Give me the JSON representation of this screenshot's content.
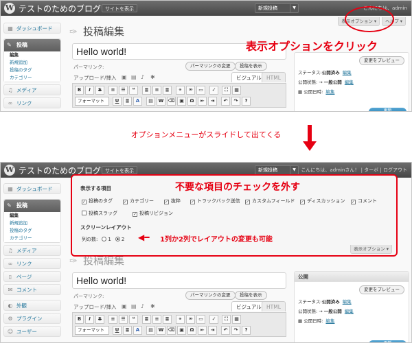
{
  "admin_bar": {
    "site_title": "テストのためのブログ",
    "view_site": "サイトを表示",
    "new_post": "新規投稿",
    "greeting": "こんにちは、adminさん！ | ターボ | ログアウト",
    "greeting_short": "こんにちは、admin"
  },
  "screen_options": {
    "label": "表示オプション ▾",
    "help": "ヘルプ ▾"
  },
  "sidebar": {
    "dashboard": "ダッシュボード",
    "posts": "投稿",
    "posts_sub": [
      "編集",
      "新規追加",
      "投稿のタグ",
      "カテゴリー"
    ],
    "media": "メディア",
    "links": "リンク",
    "pages": "ページ",
    "comments": "コメント",
    "appearance": "外観",
    "plugins": "プラグイン",
    "users": "ユーザー"
  },
  "page": {
    "title": "投稿編集"
  },
  "editor": {
    "post_title": "Hello world!",
    "permalink_label": "パーマリンク:",
    "change_permalink": "パーマリンクの変更",
    "view_post": "投稿を表示",
    "upload_label": "アップロード/挿入",
    "tab_visual": "ビジュアル",
    "tab_html": "HTML",
    "format_select": "フォーマット"
  },
  "publish_box": {
    "heading": "公開",
    "preview": "変更をプレビュー",
    "status_label": "ステータス:",
    "status_value": "公開済み",
    "visibility_label": "公開状態:",
    "visibility_value": "一般公開",
    "date_label": "公開日時:",
    "edit": "編集",
    "publish_button": "更新"
  },
  "screen_options_panel": {
    "show_heading": "表示する項目",
    "checkboxes": [
      {
        "label": "投稿のタグ",
        "checked": true
      },
      {
        "label": "カテゴリー",
        "checked": true
      },
      {
        "label": "抜粋",
        "checked": true
      },
      {
        "label": "トラックバック送信",
        "checked": true
      },
      {
        "label": "カスタムフィールド",
        "checked": true
      },
      {
        "label": "ディスカッション",
        "checked": true
      },
      {
        "label": "コメント",
        "checked": true
      },
      {
        "label": "投稿スラッグ",
        "checked": false
      },
      {
        "label": "投稿リビジョン",
        "checked": true
      }
    ],
    "layout_heading": "スクリーンレイアウト",
    "columns_label": "列の数:",
    "col1": "1",
    "col2": "2"
  },
  "annotations": {
    "click_screen_options": "表示オプションをクリック",
    "menu_slides": "オプションメニューがスライドして出てくる",
    "uncheck_items": "不要な項目のチェックを外す",
    "layout_note": "1列か2列でレイアウトの変更も可能",
    "accent_color": "#e60012"
  }
}
